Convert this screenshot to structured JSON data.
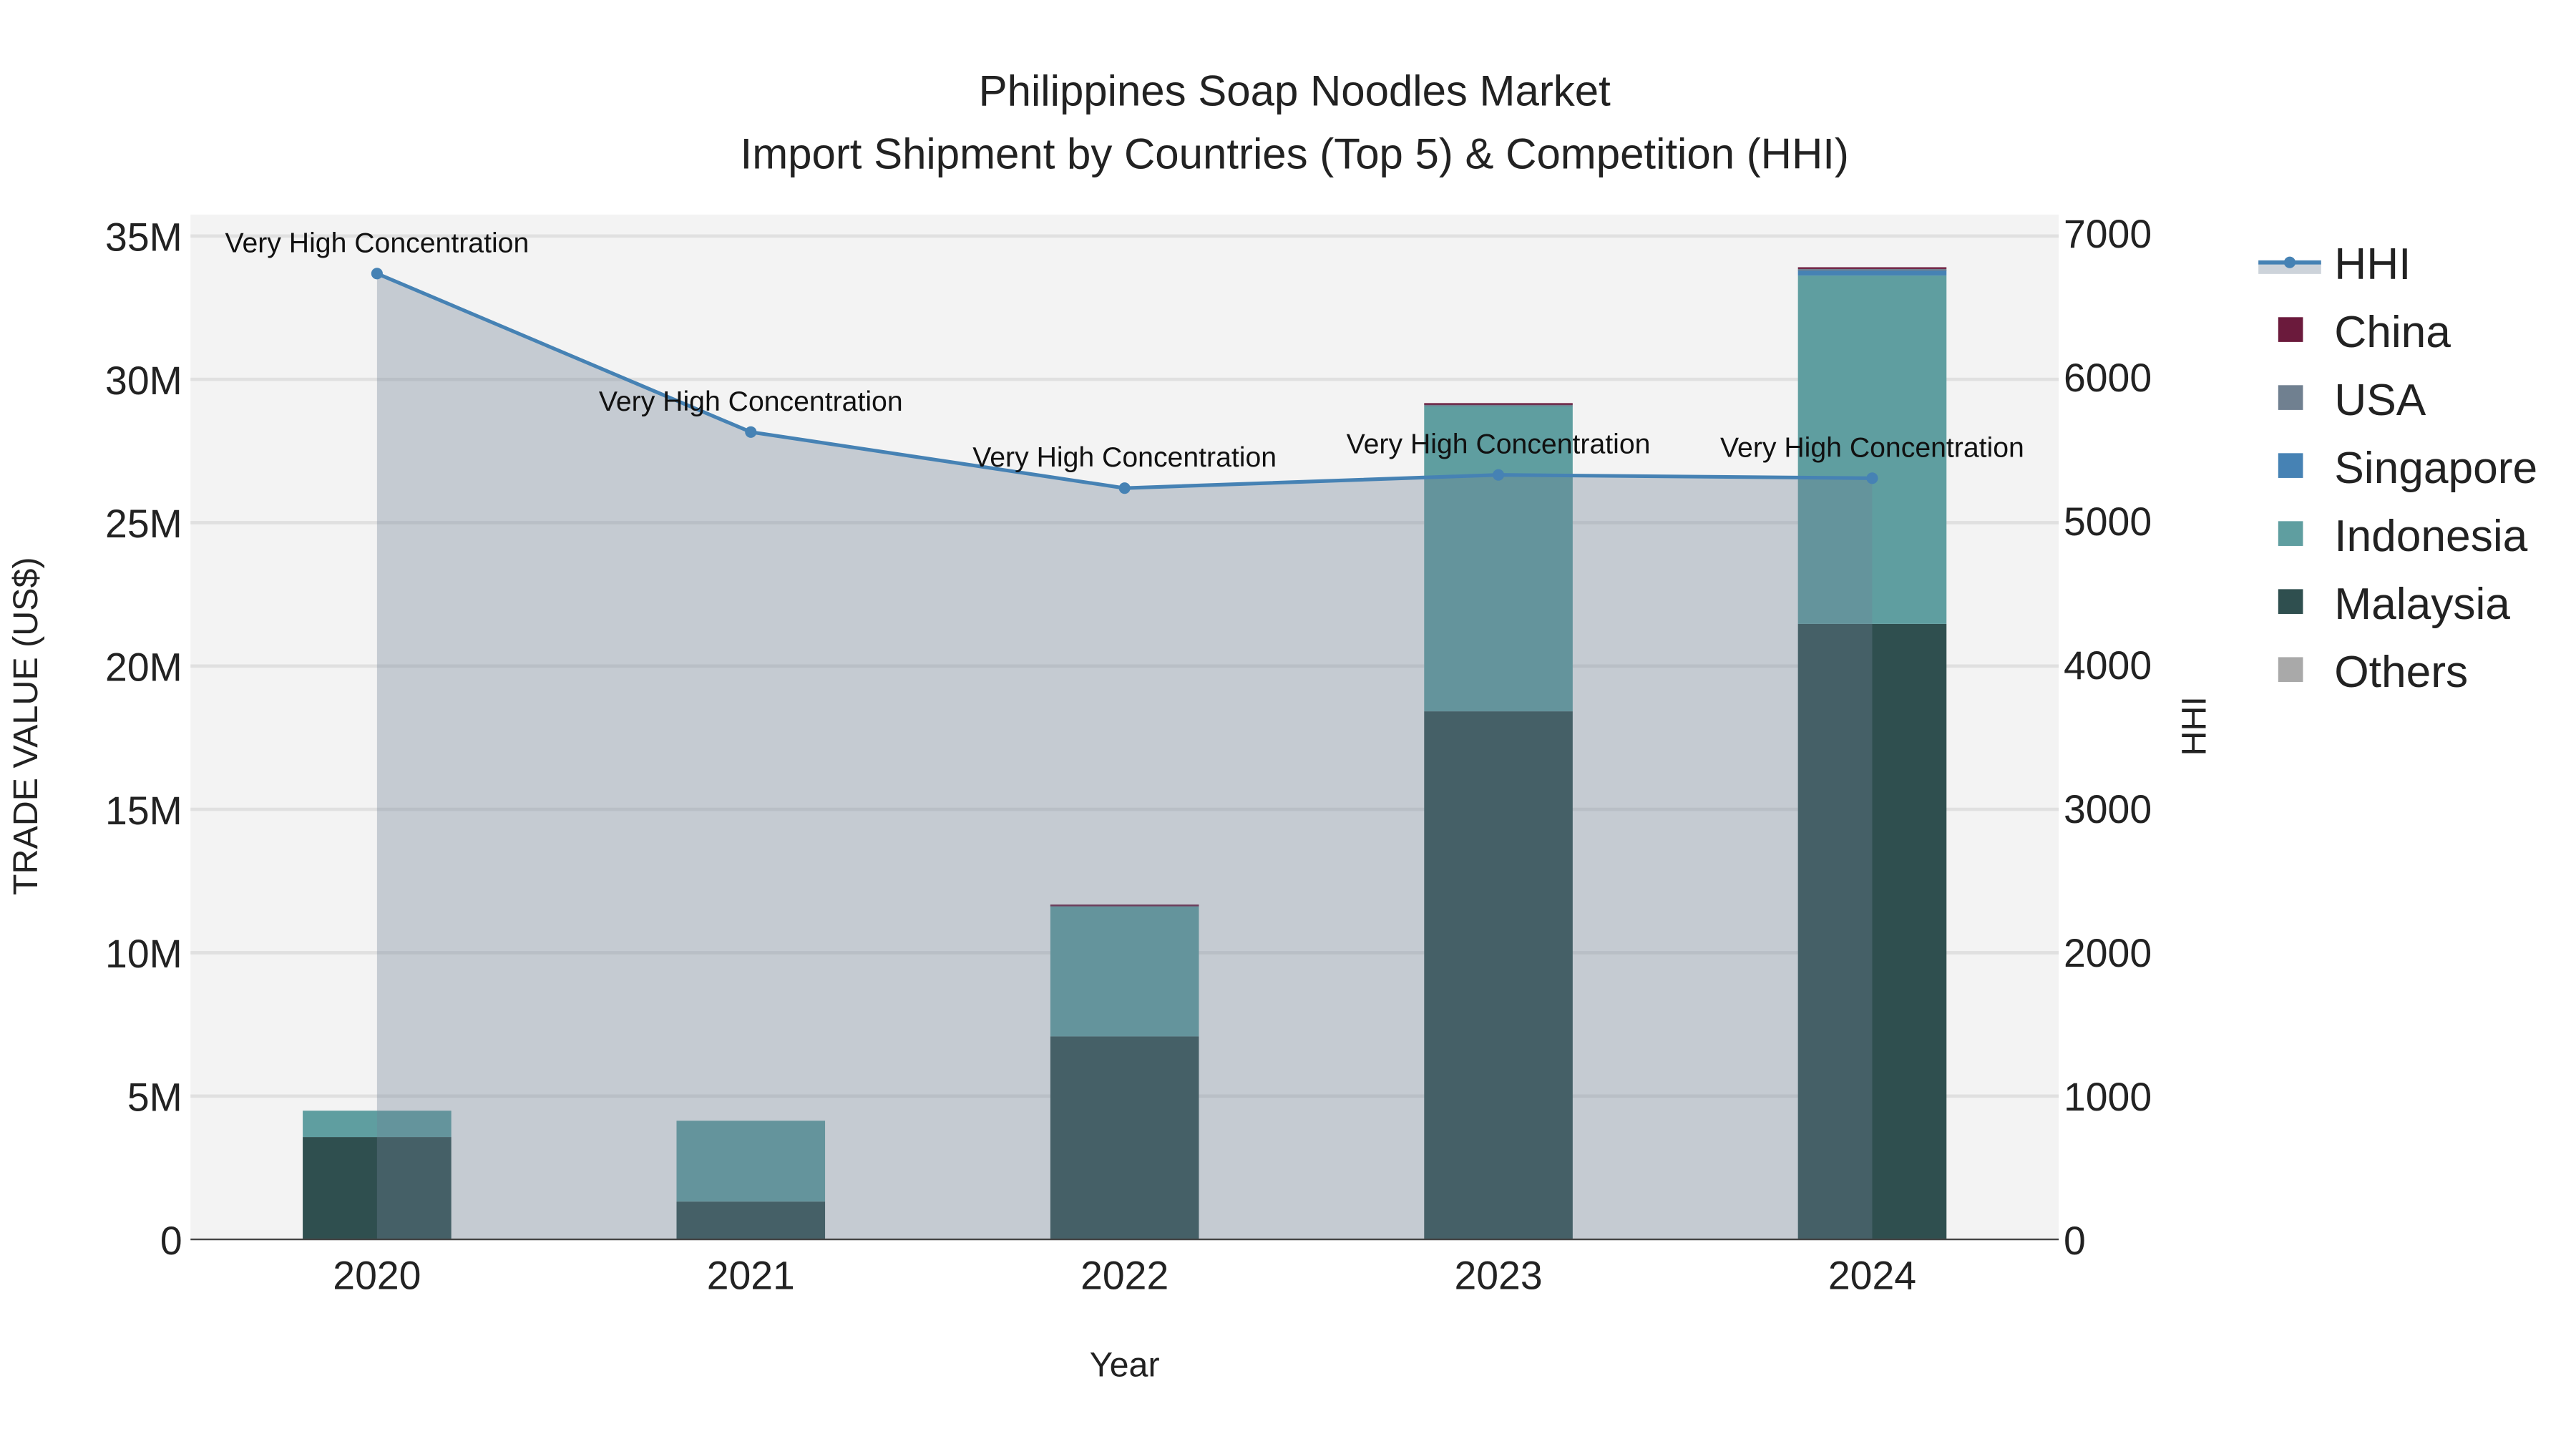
{
  "chart_data": {
    "type": "bar",
    "title": "Philippines Soap Noodles Market",
    "subtitle": "Import Shipment by Countries (Top 5) & Competition (HHI)",
    "xlabel": "Year",
    "ylabel": "TRADE VALUE (US$)",
    "y2label": "HHI",
    "categories": [
      "2020",
      "2021",
      "2022",
      "2023",
      "2024"
    ],
    "ylim": [
      0,
      35000000
    ],
    "y2lim": [
      0,
      7000
    ],
    "yticks": [
      {
        "v": 0,
        "label": "0"
      },
      {
        "v": 5000000,
        "label": "5M"
      },
      {
        "v": 10000000,
        "label": "10M"
      },
      {
        "v": 15000000,
        "label": "15M"
      },
      {
        "v": 20000000,
        "label": "20M"
      },
      {
        "v": 25000000,
        "label": "25M"
      },
      {
        "v": 30000000,
        "label": "30M"
      },
      {
        "v": 35000000,
        "label": "35M"
      }
    ],
    "y2ticks": [
      {
        "v": 0,
        "label": "0"
      },
      {
        "v": 1000,
        "label": "1000"
      },
      {
        "v": 2000,
        "label": "2000"
      },
      {
        "v": 3000,
        "label": "3000"
      },
      {
        "v": 4000,
        "label": "4000"
      },
      {
        "v": 5000,
        "label": "5000"
      },
      {
        "v": 6000,
        "label": "6000"
      },
      {
        "v": 7000,
        "label": "7000"
      }
    ],
    "barmode": "stack",
    "series": [
      {
        "name": "Malaysia",
        "color": "#2f4f4f",
        "values": [
          3570000,
          1320000,
          7080000,
          18420000,
          21470000
        ]
      },
      {
        "name": "Indonesia",
        "color": "#5f9ea0",
        "values": [
          920000,
          2820000,
          4550000,
          10650000,
          12150000
        ]
      },
      {
        "name": "Singapore",
        "color": "#4682b4",
        "values": [
          0,
          0,
          0,
          0,
          200000
        ]
      },
      {
        "name": "USA",
        "color": "#708090",
        "values": [
          0,
          0,
          30000,
          50000,
          30000
        ]
      },
      {
        "name": "China",
        "color": "#6b1a3c",
        "values": [
          0,
          0,
          20000,
          50000,
          60000
        ]
      },
      {
        "name": "Others",
        "color": "#a9a9a9",
        "values": [
          0,
          0,
          0,
          0,
          0
        ]
      }
    ],
    "hhi": {
      "name": "HHI",
      "color": "#4682b4",
      "values": [
        6716,
        5614,
        5224,
        5316,
        5293
      ],
      "annotations": [
        "Very High Concentration",
        "Very High Concentration",
        "Very High Concentration",
        "Very High Concentration",
        "Very High Concentration"
      ]
    },
    "legend": [
      "HHI",
      "China",
      "USA",
      "Singapore",
      "Indonesia",
      "Malaysia",
      "Others"
    ],
    "legend_position": "right",
    "grid": true
  }
}
